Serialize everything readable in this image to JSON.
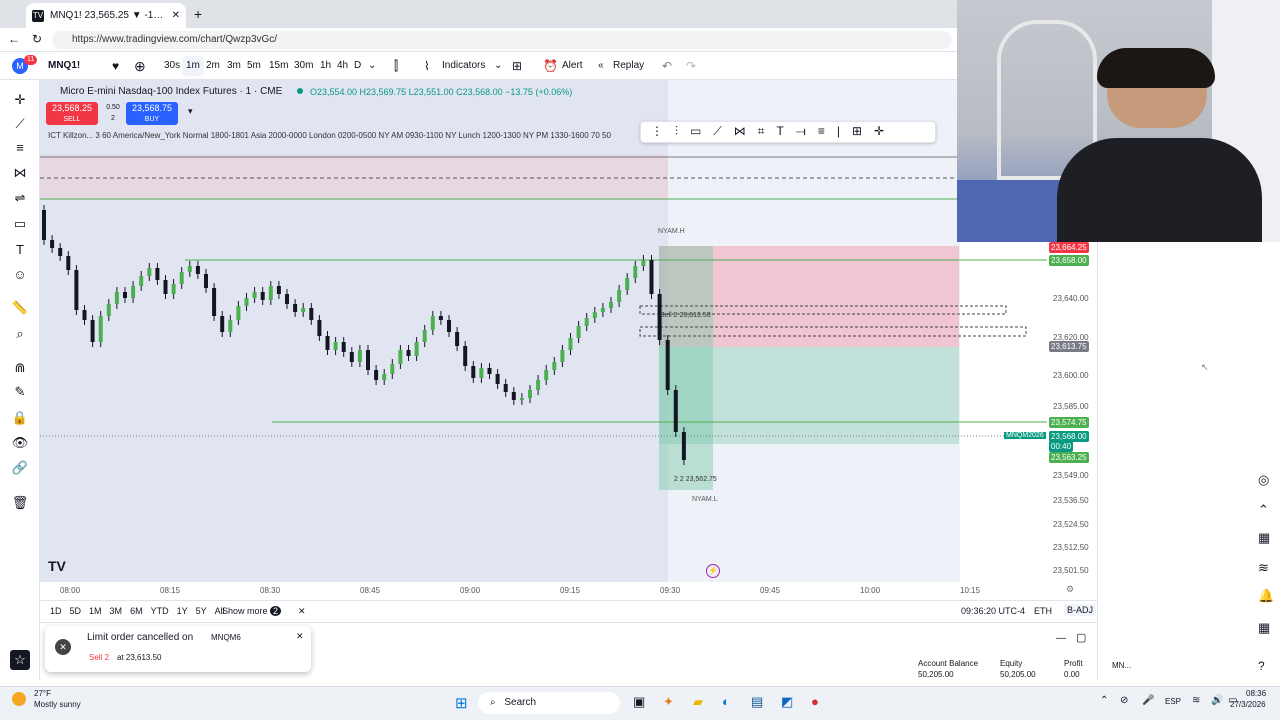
{
  "browser": {
    "tab_title": "MNQ1! 23,565.25 ▼ -1.07% Unna",
    "url": "https://www.tradingview.com/chart/Qwzp3vGc/"
  },
  "toolbar": {
    "symbol": "MNQ1!",
    "timeframes": [
      "30s",
      "1m",
      "2m",
      "3m",
      "5m",
      "15m",
      "30m",
      "1h",
      "4h",
      "D"
    ],
    "active_timeframe": "1m",
    "indicators_label": "Indicators",
    "alert_label": "Alert",
    "replay_label": "Replay",
    "notification_count": "11"
  },
  "legend": {
    "instrument": "Micro E-mini Nasdaq-100 Index Futures · 1 · CME",
    "ohlc": "O23,554.00 H23,569.75 L23,551.00 C23,568.00 −13.75 (+0.06%)",
    "sell_price": "23,568.25",
    "sell_label": "SELL",
    "spread": "0.50",
    "qty": "2",
    "buy_price": "23,568.75",
    "buy_label": "BUY",
    "indicator_line": "ICT Killzon... 3 60 America/New_York Normal 1800-1801 Asia 2000-0000 London 0200-0500 NY AM 0930-1100 NY Lunch 1200-1300 NY PM 1330-1600 70 50"
  },
  "chart_labels": {
    "nyam_h": "NYAM.H",
    "nyam_l": "NYAM.L",
    "order_a": "Sell 2  23,613.50",
    "order_b": "2  2  23,562.75",
    "symbol_tag": "MNQM2026",
    "countdown": "00:40"
  },
  "price_axis": {
    "ticks": [
      "23,640.00",
      "23,620.00",
      "23,600.00",
      "23,585.00",
      "23,549.00",
      "23,536.50",
      "23,524.50",
      "23,512.50",
      "23,501.50"
    ],
    "tags": [
      {
        "text": "23,664.25",
        "color": "#f23645"
      },
      {
        "text": "23,658.00",
        "color": "#4caf50"
      },
      {
        "text": "23,613.75",
        "color": "#787b86"
      },
      {
        "text": "23,574.75",
        "color": "#4caf50"
      },
      {
        "text": "23,568.00",
        "color": "#089981"
      },
      {
        "text": "23,563.25",
        "color": "#4caf50"
      }
    ]
  },
  "time_axis": {
    "ticks": [
      "08:00",
      "08:15",
      "08:30",
      "08:45",
      "09:00",
      "09:15",
      "09:30",
      "09:45",
      "10:00",
      "10:15"
    ]
  },
  "scalebar": {
    "ranges": [
      "1D",
      "5D",
      "1M",
      "3M",
      "6M",
      "YTD",
      "1Y",
      "5Y",
      "All"
    ],
    "show_more": "Show more",
    "show_more_count": "2",
    "clock": "09:36:20 UTC-4",
    "session": "ETH",
    "adj": "B-ADJ"
  },
  "toast": {
    "title": "Limit order cancelled on",
    "symbol": "MNQM6",
    "side": "Sell 2",
    "detail": "at 23,613.50"
  },
  "account": {
    "balance_label": "Account Balance",
    "balance": "50,205.00",
    "equity_label": "Equity",
    "equity": "50,205.00",
    "profit_label": "Profit",
    "profit": "0.00",
    "symbol_short": "MN..."
  },
  "taskbar": {
    "weather_temp": "27°F",
    "weather_desc": "Mostly sunny",
    "search": "Search",
    "lang": "ESP",
    "time": "08:36",
    "date": "27/3/2026"
  },
  "colors": {
    "up": "#26a69a",
    "down": "#131722",
    "candle_up": "#4caf50",
    "sell": "#f23645",
    "buy": "#2962ff"
  }
}
